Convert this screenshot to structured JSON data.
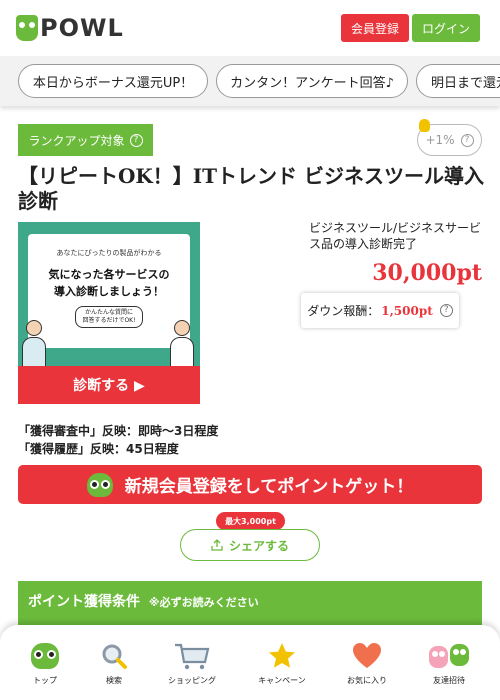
{
  "header": {
    "logo_text": "POWL",
    "register_label": "会員登録",
    "login_label": "ログイン"
  },
  "tabs": [
    {
      "label": "本日からボーナス還元UP！"
    },
    {
      "label": "カンタン！アンケート回答♪"
    },
    {
      "label": "明日まで還元"
    }
  ],
  "offer": {
    "rankup_label": "ランクアップ対象",
    "bonus_label": "+1%",
    "title": "【リピートOK！】ITトレンド ビジネスツール導入診断",
    "category": "ビジネスツール/ビジネスサービス品の導入診断完了",
    "points": "30,000pt",
    "down_label": "ダウン報酬：",
    "down_value": "1,500pt",
    "review_line_1": "「獲得審査中」反映：即時～3日程度",
    "review_line_2": "「獲得履歴」反映：45日程度"
  },
  "banner": {
    "small_text": "あなたにぴったりの製品がわかる",
    "main_line_1": "気になった各サービスの",
    "main_line_2": "導入診断しましょう！",
    "sub_text_1": "かんたんな質問に",
    "sub_text_2": "回答するだけでOK!",
    "cta": "診断する ▶"
  },
  "signup_banner": {
    "label": "新規会員登録をしてポイントゲット！"
  },
  "share": {
    "badge": "最大3,000pt",
    "label": "シェアする"
  },
  "conditions": {
    "title": "ポイント獲得条件",
    "note": "※必ずお読みください"
  },
  "bottom_nav": [
    {
      "label": "トップ",
      "icon": "owl-icon"
    },
    {
      "label": "検索",
      "icon": "search-icon"
    },
    {
      "label": "ショッピング",
      "icon": "cart-icon"
    },
    {
      "label": "キャンペーン",
      "icon": "star-icon"
    },
    {
      "label": "お気に入り",
      "icon": "heart-icon"
    },
    {
      "label": "友達招待",
      "icon": "friends-icon"
    }
  ],
  "colors": {
    "red": "#e8343a",
    "green": "#6cba3c",
    "star": "#f2c200",
    "heart": "#f0704d"
  }
}
